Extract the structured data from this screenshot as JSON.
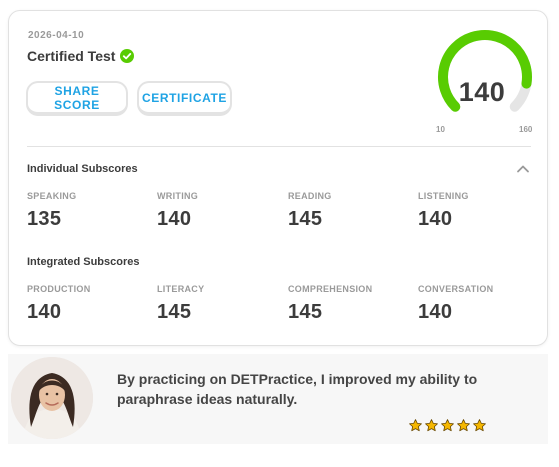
{
  "result": {
    "date": "2026-04-10",
    "test_name": "Certified Test",
    "verified_icon": "check-circle-icon",
    "share_label": "SHARE SCORE",
    "certificate_label": "CERTIFICATE"
  },
  "score": {
    "overall": "140",
    "scale_min": "10",
    "scale_max": "160",
    "value": 140,
    "min": 10,
    "max": 160
  },
  "individual": {
    "title": "Individual Subscores",
    "items": [
      {
        "label": "SPEAKING",
        "value": "135"
      },
      {
        "label": "WRITING",
        "value": "140"
      },
      {
        "label": "READING",
        "value": "145"
      },
      {
        "label": "LISTENING",
        "value": "140"
      }
    ]
  },
  "integrated": {
    "title": "Integrated Subscores",
    "items": [
      {
        "label": "PRODUCTION",
        "value": "140"
      },
      {
        "label": "LITERACY",
        "value": "145"
      },
      {
        "label": "COMPREHENSION",
        "value": "145"
      },
      {
        "label": "CONVERSATION",
        "value": "140"
      }
    ]
  },
  "testimonial": {
    "quote": "By practicing on DETPractice, I improved my ability to paraphrase ideas naturally.",
    "rating": 5,
    "star_icon": "star-icon"
  },
  "colors": {
    "gauge_fill": "#58cc02",
    "gauge_track": "#e5e5e5",
    "accent_blue": "#1fa3e4",
    "verified_green": "#58cc02",
    "star_fill": "#f5b700"
  }
}
